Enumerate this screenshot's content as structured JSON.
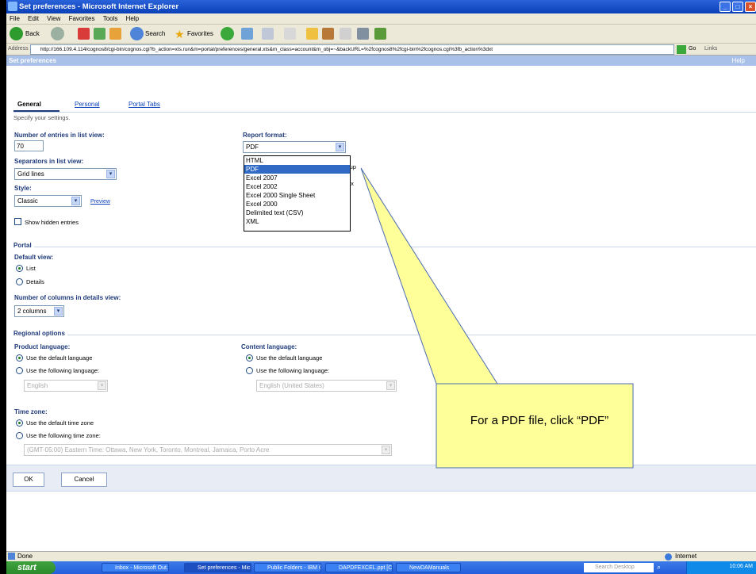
{
  "window": {
    "title": "Set preferences - Microsoft Internet Explorer"
  },
  "menu": [
    "File",
    "Edit",
    "View",
    "Favorites",
    "Tools",
    "Help"
  ],
  "toolbar": {
    "back": "Back",
    "search": "Search",
    "favorites": "Favorites"
  },
  "address": {
    "label": "Address",
    "url": "http://166.109.4.114/cognos8/cgi-bin/cognos.cgi?b_action=xts.run&m=portal/preferences/general.xts&m_class=account&m_obj=~&backURL=%2fcognos8%2fcgi-bin%2fcognos.cgi%3fb_action%3dxt",
    "go": "Go",
    "links": "Links"
  },
  "page": {
    "header": "Set preferences",
    "help": "Help"
  },
  "tabs": [
    "General",
    "Personal",
    "Portal Tabs"
  ],
  "subtitle": "Specify your settings.",
  "general": {
    "entries_label": "Number of entries in list view:",
    "entries_value": "70",
    "separators_label": "Separators in list view:",
    "separators_value": "Grid lines",
    "style_label": "Style:",
    "style_value": "Classic",
    "preview": "Preview",
    "show_hidden": "Show hidden entries",
    "report_label": "Report format:",
    "report_value": "PDF",
    "report_options": [
      "HTML",
      "PDF",
      "Excel 2007",
      "Excel 2002",
      "Excel 2000 Single Sheet",
      "Excel 2000",
      "Delimited text (CSV)",
      "XML"
    ],
    "report_highlighted": "PDF",
    "behind_1": "rtup",
    "behind_2": "ex"
  },
  "portal": {
    "title": "Portal",
    "default_view": "Default view:",
    "list": "List",
    "details": "Details",
    "columns_label": "Number of columns in details view:",
    "columns_value": "2 columns"
  },
  "regional": {
    "title": "Regional options",
    "product_label": "Product language:",
    "content_label": "Content language:",
    "use_default": "Use the default language",
    "use_following": "Use the following language:",
    "product_value": "English",
    "content_value": "English (United States)",
    "tz_label": "Time zone:",
    "tz_default": "Use the default time zone",
    "tz_following": "Use the following time zone:",
    "tz_value": "(GMT-05:00) Eastern Time: Ottawa, New York, Toronto, Montreal, Jamaica, Porto Acre"
  },
  "buttons": {
    "ok": "OK",
    "cancel": "Cancel"
  },
  "callout": {
    "text": "For  a PDF file, click “PDF”"
  },
  "status": {
    "left": "Done",
    "zone": "Internet"
  },
  "taskbar": {
    "start": "start",
    "tasks": [
      "Inbox - Microsoft Out...",
      "Set preferences - Mic...",
      "Public Folders - IBM C...",
      "DAPDFEXCEL.ppt [Co...",
      "NewDAManuals"
    ],
    "search": "Search Desktop",
    "clock": "10:06 AM"
  }
}
